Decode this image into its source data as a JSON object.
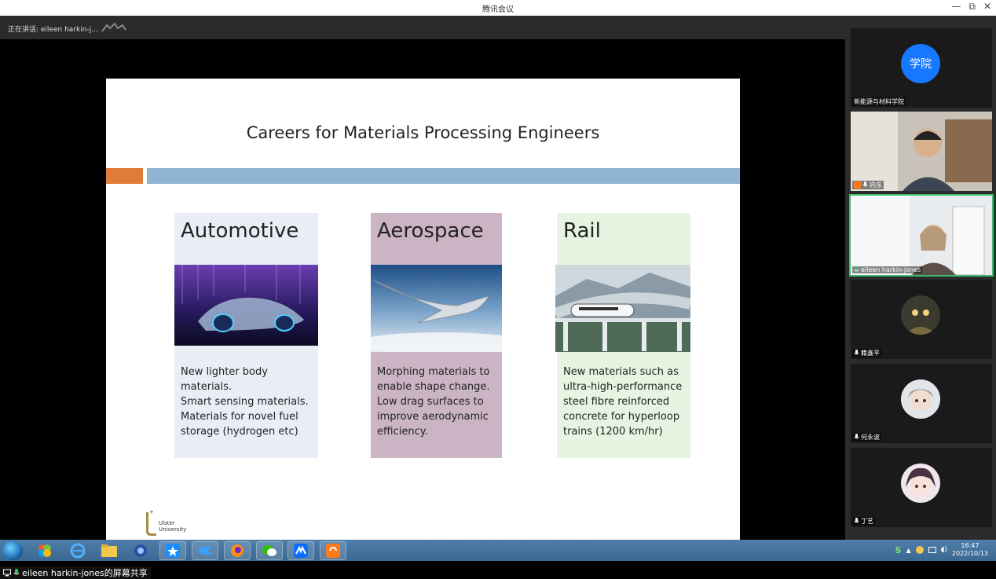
{
  "window": {
    "title": "腾讯会议",
    "minimize": "—",
    "restore": "⧉",
    "close": "✕"
  },
  "speaker": {
    "label": "正在讲话: eileen harkin-j..."
  },
  "slide": {
    "title": "Careers for Materials Processing Engineers",
    "cards": [
      {
        "title": "Automotive",
        "description": "New lighter body\nmaterials.\nSmart sensing materials.\nMaterials for novel fuel\nstorage (hydrogen etc)"
      },
      {
        "title": "Aerospace",
        "description": "Morphing materials to\nenable shape change.\nLow drag surfaces to\nimprove aerodynamic\nefficiency."
      },
      {
        "title": "Rail",
        "description": "New materials such as\nultra-high-performance\nsteel fibre reinforced\nconcrete for hyperloop\ntrains (1200 km/hr)"
      }
    ],
    "logo_text": "Ulster\nUniversity"
  },
  "share": {
    "label": "eileen harkin-jones的屏幕共享"
  },
  "participants": [
    {
      "name": "新能源与材料学院",
      "avatar_text": "学院"
    },
    {
      "name": "向东"
    },
    {
      "name": "eileen harkin-jones"
    },
    {
      "name": "籍鑫平"
    },
    {
      "name": "何永波"
    },
    {
      "name": "丁艺"
    }
  ],
  "taskbar": {
    "time": "16:47",
    "date": "2022/10/13"
  },
  "colors": {
    "accent_orange": "#e07b39",
    "accent_blue": "#92b4d4",
    "active_speaker": "#3cbf6a",
    "avatar_blue": "#1677ff"
  }
}
